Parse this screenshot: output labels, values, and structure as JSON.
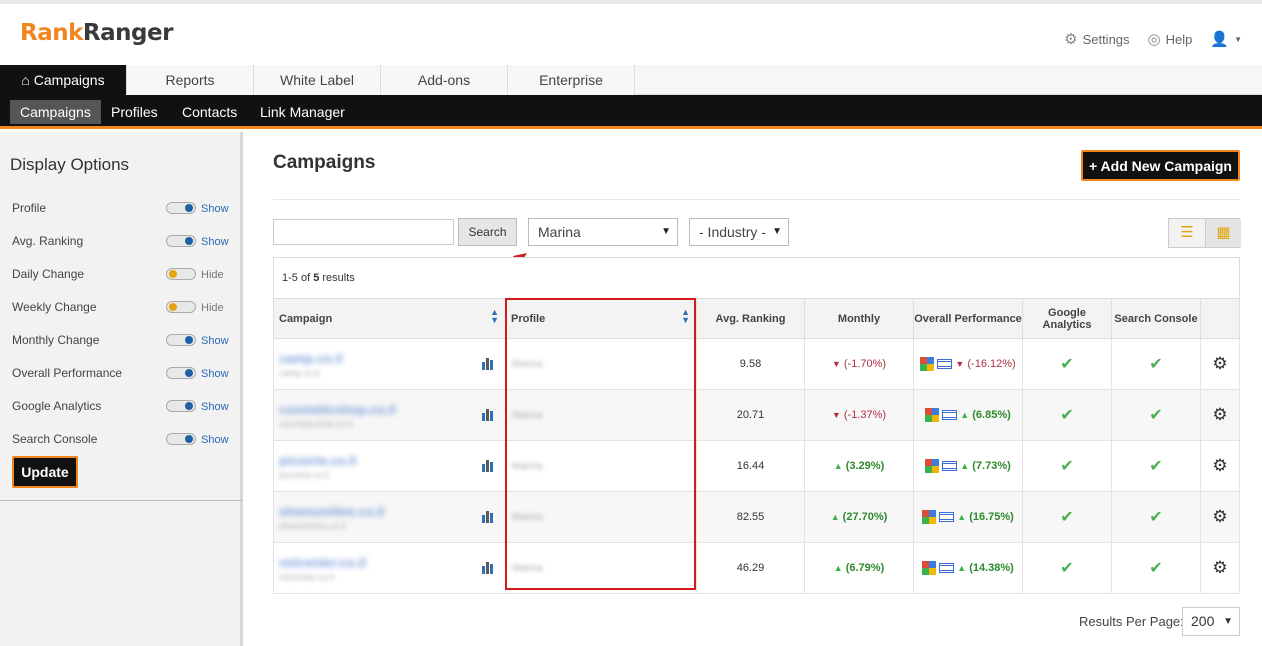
{
  "brand": {
    "part1": "Rank",
    "part2": "Ranger"
  },
  "top_links": {
    "settings": "Settings",
    "help": "Help"
  },
  "tabs": [
    "Campaigns",
    "Reports",
    "White Label",
    "Add-ons",
    "Enterprise"
  ],
  "subnav": [
    "Campaigns",
    "Profiles",
    "Contacts",
    "Link Manager"
  ],
  "sidebar": {
    "title": "Display Options",
    "options": [
      {
        "label": "Profile",
        "state": "Show"
      },
      {
        "label": "Avg. Ranking",
        "state": "Show"
      },
      {
        "label": "Daily Change",
        "state": "Hide"
      },
      {
        "label": "Weekly Change",
        "state": "Hide"
      },
      {
        "label": "Monthly Change",
        "state": "Show"
      },
      {
        "label": "Overall Performance",
        "state": "Show"
      },
      {
        "label": "Google Analytics",
        "state": "Show"
      },
      {
        "label": "Search Console",
        "state": "Show"
      }
    ],
    "update": "Update"
  },
  "main": {
    "title": "Campaigns",
    "add_button": "+ Add New Campaign",
    "search_button": "Search",
    "profile_select": "Marina",
    "industry_select": "- Industry -",
    "results_prefix": "1-5 of ",
    "results_count": "5",
    "results_suffix": " results"
  },
  "table": {
    "headers": {
      "campaign": "Campaign",
      "profile": "Profile",
      "avg": "Avg. Ranking",
      "monthly": "Monthly",
      "overall": "Overall Performance",
      "ga": "Google Analytics",
      "sc": "Search Console"
    },
    "rows": [
      {
        "campaign": "camp.co.il",
        "sub": "camp.co.il",
        "profile": "Marina",
        "avg": "9.58",
        "monthly": "(-1.70%)",
        "monthly_dir": "down",
        "overall": "(-16.12%)",
        "overall_dir": "down"
      },
      {
        "campaign": "cosmeticshop.co.il",
        "sub": "cosmeticshop.co.il",
        "profile": "Marina",
        "avg": "20.71",
        "monthly": "(-1.37%)",
        "monthly_dir": "down",
        "overall": "(6.85%)",
        "overall_dir": "up"
      },
      {
        "campaign": "pizzeria.co.il",
        "sub": "pizzeria.co.il",
        "profile": "Marina",
        "avg": "16.44",
        "monthly": "(3.29%)",
        "monthly_dir": "up",
        "overall": "(7.73%)",
        "overall_dir": "up"
      },
      {
        "campaign": "shoesonline.co.il",
        "sub": "shoesonline.co.il",
        "profile": "Marina",
        "avg": "82.55",
        "monthly": "(27.70%)",
        "monthly_dir": "up",
        "overall": "(16.75%)",
        "overall_dir": "up"
      },
      {
        "campaign": "vetcenter.co.il",
        "sub": "vetcenter.co.il",
        "profile": "Marina",
        "avg": "46.29",
        "monthly": "(6.79%)",
        "monthly_dir": "up",
        "overall": "(14.38%)",
        "overall_dir": "up"
      }
    ]
  },
  "footer": {
    "rpp_label": "Results Per Page:",
    "rpp_value": "200"
  },
  "colors": {
    "accent": "#f0861d",
    "nav_bg": "#111111",
    "link": "#2a69b3",
    "annotation": "#d11b1b"
  }
}
